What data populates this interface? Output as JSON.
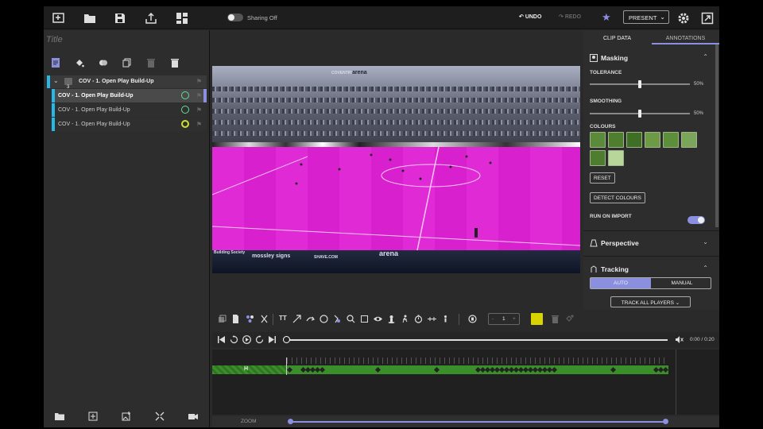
{
  "topbar": {
    "sharing_label": "Sharing Off",
    "undo_label": "UNDO",
    "redo_label": "REDO",
    "present_label": "PRESENT"
  },
  "left": {
    "title": "Title",
    "folder": {
      "badge": "3",
      "label": "COV - 1. Open Play Build-Up"
    },
    "clips": [
      {
        "label": "COV - 1. Open Play Build-Up"
      },
      {
        "label": "COV - 1. Open Play Build-Up"
      },
      {
        "label": "COV - 1. Open Play Build-Up"
      }
    ]
  },
  "video": {
    "ads": [
      "COVENTRY",
      "arena",
      "mossley signs",
      "SHAVE.COM",
      "arena",
      "Building Society"
    ]
  },
  "panel": {
    "tabs": [
      "CLIP DATA",
      "ANNOTATIONS"
    ],
    "masking": {
      "title": "Masking",
      "tolerance_label": "TOLERANCE",
      "tolerance_value": "50%",
      "smoothing_label": "SMOOTHING",
      "smoothing_value": "50%",
      "colours_label": "COLOURS",
      "swatches": [
        "#5b8a3a",
        "#4f7f2e",
        "#3f6f24",
        "#6d9a45",
        "#5d8f3a",
        "#7aa55a",
        "#4e7d30",
        "#b9d69a"
      ],
      "reset_label": "RESET",
      "detect_label": "DETECT COLOURS",
      "run_label": "RUN ON IMPORT"
    },
    "perspective": {
      "title": "Perspective"
    },
    "tracking": {
      "title": "Tracking",
      "auto_label": "AUTO",
      "manual_label": "MANUAL",
      "track_all_label": "TRACK ALL PLAYERS"
    }
  },
  "toolbar": {
    "stepper_value": "1",
    "stepper_minus": "-",
    "stepper_plus": "+",
    "text_tool": "TT"
  },
  "transport": {
    "time": "0:00 / 0:20"
  },
  "timeline": {
    "zoom_label": "ZOOM",
    "track_label": "H"
  },
  "colors": {
    "accent": "#8b8fe0",
    "clip_marker": "#29b6e8",
    "track": "#3b8f2a",
    "mask": "#e02ad6"
  }
}
